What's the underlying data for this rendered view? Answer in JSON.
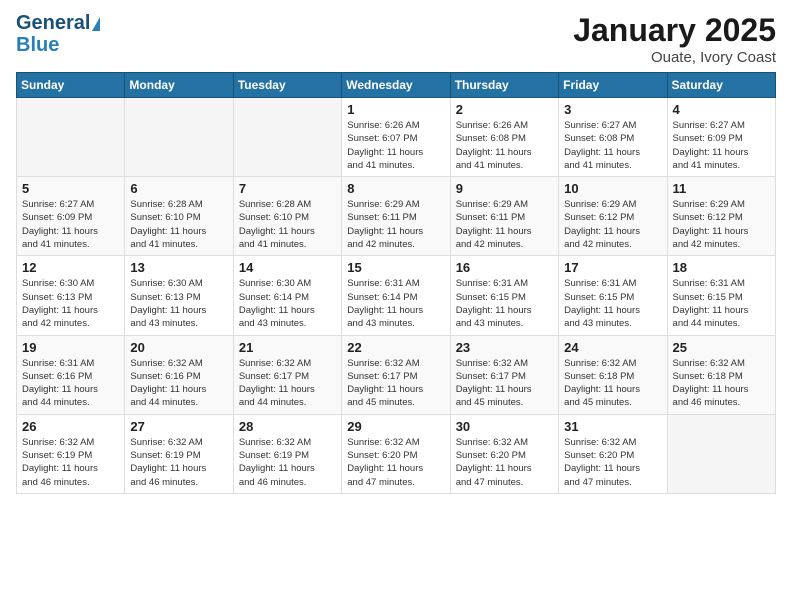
{
  "header": {
    "logo_line1": "General",
    "logo_line2": "Blue",
    "main_title": "January 2025",
    "subtitle": "Ouate, Ivory Coast"
  },
  "days_of_week": [
    "Sunday",
    "Monday",
    "Tuesday",
    "Wednesday",
    "Thursday",
    "Friday",
    "Saturday"
  ],
  "weeks": [
    {
      "days": [
        {
          "number": "",
          "info": ""
        },
        {
          "number": "",
          "info": ""
        },
        {
          "number": "",
          "info": ""
        },
        {
          "number": "1",
          "info": "Sunrise: 6:26 AM\nSunset: 6:07 PM\nDaylight: 11 hours\nand 41 minutes."
        },
        {
          "number": "2",
          "info": "Sunrise: 6:26 AM\nSunset: 6:08 PM\nDaylight: 11 hours\nand 41 minutes."
        },
        {
          "number": "3",
          "info": "Sunrise: 6:27 AM\nSunset: 6:08 PM\nDaylight: 11 hours\nand 41 minutes."
        },
        {
          "number": "4",
          "info": "Sunrise: 6:27 AM\nSunset: 6:09 PM\nDaylight: 11 hours\nand 41 minutes."
        }
      ]
    },
    {
      "days": [
        {
          "number": "5",
          "info": "Sunrise: 6:27 AM\nSunset: 6:09 PM\nDaylight: 11 hours\nand 41 minutes."
        },
        {
          "number": "6",
          "info": "Sunrise: 6:28 AM\nSunset: 6:10 PM\nDaylight: 11 hours\nand 41 minutes."
        },
        {
          "number": "7",
          "info": "Sunrise: 6:28 AM\nSunset: 6:10 PM\nDaylight: 11 hours\nand 41 minutes."
        },
        {
          "number": "8",
          "info": "Sunrise: 6:29 AM\nSunset: 6:11 PM\nDaylight: 11 hours\nand 42 minutes."
        },
        {
          "number": "9",
          "info": "Sunrise: 6:29 AM\nSunset: 6:11 PM\nDaylight: 11 hours\nand 42 minutes."
        },
        {
          "number": "10",
          "info": "Sunrise: 6:29 AM\nSunset: 6:12 PM\nDaylight: 11 hours\nand 42 minutes."
        },
        {
          "number": "11",
          "info": "Sunrise: 6:29 AM\nSunset: 6:12 PM\nDaylight: 11 hours\nand 42 minutes."
        }
      ]
    },
    {
      "days": [
        {
          "number": "12",
          "info": "Sunrise: 6:30 AM\nSunset: 6:13 PM\nDaylight: 11 hours\nand 42 minutes."
        },
        {
          "number": "13",
          "info": "Sunrise: 6:30 AM\nSunset: 6:13 PM\nDaylight: 11 hours\nand 43 minutes."
        },
        {
          "number": "14",
          "info": "Sunrise: 6:30 AM\nSunset: 6:14 PM\nDaylight: 11 hours\nand 43 minutes."
        },
        {
          "number": "15",
          "info": "Sunrise: 6:31 AM\nSunset: 6:14 PM\nDaylight: 11 hours\nand 43 minutes."
        },
        {
          "number": "16",
          "info": "Sunrise: 6:31 AM\nSunset: 6:15 PM\nDaylight: 11 hours\nand 43 minutes."
        },
        {
          "number": "17",
          "info": "Sunrise: 6:31 AM\nSunset: 6:15 PM\nDaylight: 11 hours\nand 43 minutes."
        },
        {
          "number": "18",
          "info": "Sunrise: 6:31 AM\nSunset: 6:15 PM\nDaylight: 11 hours\nand 44 minutes."
        }
      ]
    },
    {
      "days": [
        {
          "number": "19",
          "info": "Sunrise: 6:31 AM\nSunset: 6:16 PM\nDaylight: 11 hours\nand 44 minutes."
        },
        {
          "number": "20",
          "info": "Sunrise: 6:32 AM\nSunset: 6:16 PM\nDaylight: 11 hours\nand 44 minutes."
        },
        {
          "number": "21",
          "info": "Sunrise: 6:32 AM\nSunset: 6:17 PM\nDaylight: 11 hours\nand 44 minutes."
        },
        {
          "number": "22",
          "info": "Sunrise: 6:32 AM\nSunset: 6:17 PM\nDaylight: 11 hours\nand 45 minutes."
        },
        {
          "number": "23",
          "info": "Sunrise: 6:32 AM\nSunset: 6:17 PM\nDaylight: 11 hours\nand 45 minutes."
        },
        {
          "number": "24",
          "info": "Sunrise: 6:32 AM\nSunset: 6:18 PM\nDaylight: 11 hours\nand 45 minutes."
        },
        {
          "number": "25",
          "info": "Sunrise: 6:32 AM\nSunset: 6:18 PM\nDaylight: 11 hours\nand 46 minutes."
        }
      ]
    },
    {
      "days": [
        {
          "number": "26",
          "info": "Sunrise: 6:32 AM\nSunset: 6:19 PM\nDaylight: 11 hours\nand 46 minutes."
        },
        {
          "number": "27",
          "info": "Sunrise: 6:32 AM\nSunset: 6:19 PM\nDaylight: 11 hours\nand 46 minutes."
        },
        {
          "number": "28",
          "info": "Sunrise: 6:32 AM\nSunset: 6:19 PM\nDaylight: 11 hours\nand 46 minutes."
        },
        {
          "number": "29",
          "info": "Sunrise: 6:32 AM\nSunset: 6:20 PM\nDaylight: 11 hours\nand 47 minutes."
        },
        {
          "number": "30",
          "info": "Sunrise: 6:32 AM\nSunset: 6:20 PM\nDaylight: 11 hours\nand 47 minutes."
        },
        {
          "number": "31",
          "info": "Sunrise: 6:32 AM\nSunset: 6:20 PM\nDaylight: 11 hours\nand 47 minutes."
        },
        {
          "number": "",
          "info": ""
        }
      ]
    }
  ]
}
